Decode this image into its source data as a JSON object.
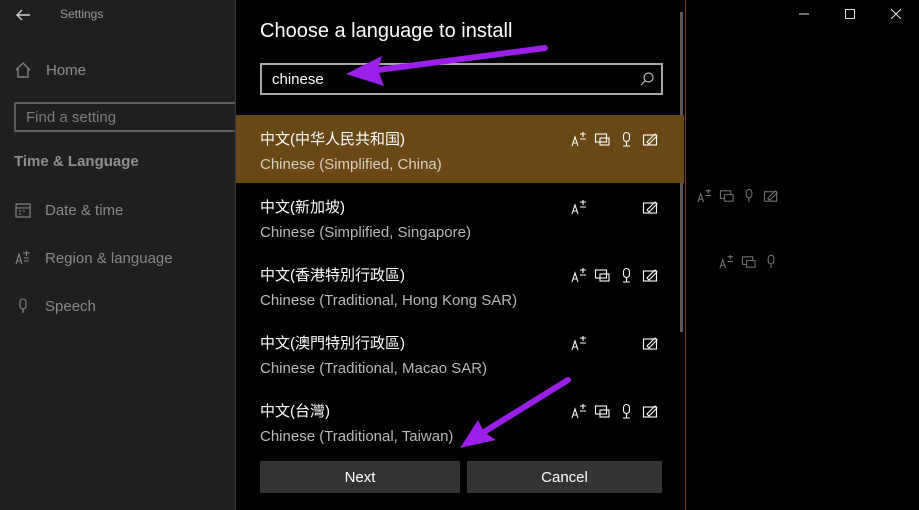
{
  "settings_window": {
    "title": "Settings",
    "home_label": "Home",
    "find_placeholder": "Find a setting",
    "section_title": "Time & Language",
    "nav_items": [
      {
        "label": "Date & time",
        "icon": "calendar-icon"
      },
      {
        "label": "Region & language",
        "icon": "language-icon"
      },
      {
        "label": "Speech",
        "icon": "microphone-icon"
      }
    ]
  },
  "dialog": {
    "title": "Choose a language to install",
    "search": {
      "value": "chinese",
      "icon": "search-icon"
    },
    "languages": [
      {
        "native": "中文(中华人民共和国)",
        "english": "Chinese (Simplified, China)",
        "selected": true,
        "features": [
          "language-pack",
          "text-to-speech",
          "speech-recognition",
          "handwriting"
        ]
      },
      {
        "native": "中文(新加坡)",
        "english": "Chinese (Simplified, Singapore)",
        "selected": false,
        "features": [
          "language-pack",
          "handwriting"
        ]
      },
      {
        "native": "中文(香港特別行政區)",
        "english": "Chinese (Traditional, Hong Kong SAR)",
        "selected": false,
        "features": [
          "language-pack",
          "text-to-speech",
          "speech-recognition",
          "handwriting"
        ]
      },
      {
        "native": "中文(澳門特別行政區)",
        "english": "Chinese (Traditional, Macao SAR)",
        "selected": false,
        "features": [
          "language-pack",
          "handwriting"
        ]
      },
      {
        "native": "中文(台灣)",
        "english": "Chinese (Traditional, Taiwan)",
        "selected": false,
        "features": [
          "language-pack",
          "text-to-speech",
          "speech-recognition",
          "handwriting"
        ]
      }
    ],
    "next_label": "Next",
    "cancel_label": "Cancel"
  },
  "colors": {
    "selected_row": "#6a4717",
    "annotation_arrow": "#9b1fe8"
  }
}
